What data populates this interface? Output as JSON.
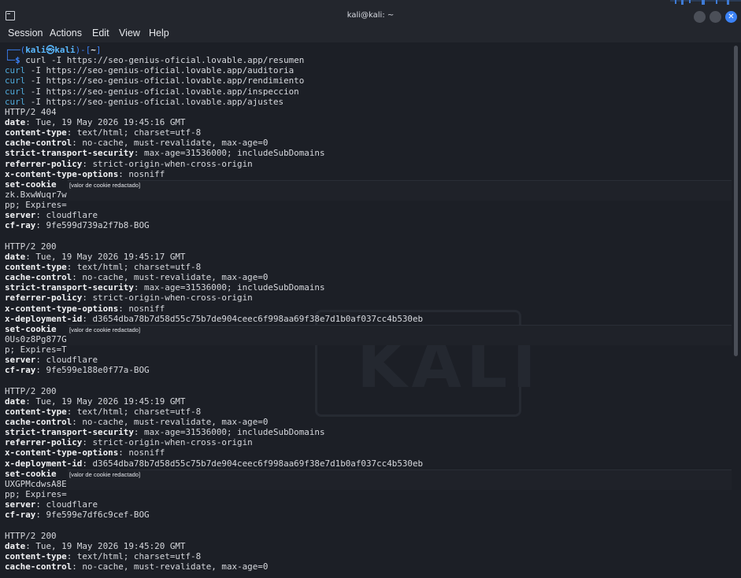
{
  "window": {
    "title": "kali@kali: ~",
    "close_glyph": "✕",
    "icons": [
      "terminal-icon",
      "minimize-icon",
      "maximize-icon",
      "close-icon"
    ]
  },
  "menu": [
    "Session",
    "Actions",
    "Edit",
    "View",
    "Help"
  ],
  "prompt": {
    "open": "┌──(",
    "user": "kali㉿kali",
    "mid": ")-[",
    "path": "~",
    "close": "]",
    "arrow": "└─",
    "dollar": "$",
    "command": " curl -I https://seo-genius-oficial.lovable.app/resumen"
  },
  "commands": [
    {
      "cmd": "curl",
      "rest": " -I https://seo-genius-oficial.lovable.app/auditoria"
    },
    {
      "cmd": "curl",
      "rest": " -I https://seo-genius-oficial.lovable.app/rendimiento"
    },
    {
      "cmd": "curl",
      "rest": " -I https://seo-genius-oficial.lovable.app/inspeccion"
    },
    {
      "cmd": "curl",
      "rest": " -I https://seo-genius-oficial.lovable.app/ajustes"
    }
  ],
  "redaction_label": "[valor de cookie redactado]",
  "responses": [
    {
      "status": "HTTP/2 404",
      "headers": [
        {
          "k": "date",
          "v": ": Tue, 19 May 2026 19:45:16 GMT"
        },
        {
          "k": "content-type",
          "v": ": text/html; charset=utf-8"
        },
        {
          "k": "cache-control",
          "v": ": no-cache, must-revalidate, max-age=0"
        },
        {
          "k": "strict-transport-security",
          "v": ": max-age=31536000; includeSubDomains"
        },
        {
          "k": "referrer-policy",
          "v": ": strict-origin-when-cross-origin"
        },
        {
          "k": "x-content-type-options",
          "v": ": nosniff"
        },
        {
          "k": "set-cookie",
          "v": ""
        }
      ],
      "cookie_lines": [
        "zk.BxwWuqr7w",
        "pp; Expires="
      ],
      "tail": [
        {
          "k": "server",
          "v": ": cloudflare"
        },
        {
          "k": "cf-ray",
          "v": ": 9fe599d739a2f7b8-BOG"
        }
      ]
    },
    {
      "status": "HTTP/2 200",
      "headers": [
        {
          "k": "date",
          "v": ": Tue, 19 May 2026 19:45:17 GMT"
        },
        {
          "k": "content-type",
          "v": ": text/html; charset=utf-8"
        },
        {
          "k": "cache-control",
          "v": ": no-cache, must-revalidate, max-age=0"
        },
        {
          "k": "strict-transport-security",
          "v": ": max-age=31536000; includeSubDomains"
        },
        {
          "k": "referrer-policy",
          "v": ": strict-origin-when-cross-origin"
        },
        {
          "k": "x-content-type-options",
          "v": ": nosniff"
        },
        {
          "k": "x-deployment-id",
          "v": ": d3654dba78b7d58d55c75b7de904ceec6f998aa69f38e7d1b0af037cc4b530eb"
        },
        {
          "k": "set-cookie",
          "v": ""
        }
      ],
      "cookie_lines": [
        "0Us0z8Pg877G",
        "p; Expires=T"
      ],
      "tail": [
        {
          "k": "server",
          "v": ": cloudflare"
        },
        {
          "k": "cf-ray",
          "v": ": 9fe599e188e0f77a-BOG"
        }
      ]
    },
    {
      "status": "HTTP/2 200",
      "headers": [
        {
          "k": "date",
          "v": ": Tue, 19 May 2026 19:45:19 GMT"
        },
        {
          "k": "content-type",
          "v": ": text/html; charset=utf-8"
        },
        {
          "k": "cache-control",
          "v": ": no-cache, must-revalidate, max-age=0"
        },
        {
          "k": "strict-transport-security",
          "v": ": max-age=31536000; includeSubDomains"
        },
        {
          "k": "referrer-policy",
          "v": ": strict-origin-when-cross-origin"
        },
        {
          "k": "x-content-type-options",
          "v": ": nosniff"
        },
        {
          "k": "x-deployment-id",
          "v": ": d3654dba78b7d58d55c75b7de904ceec6f998aa69f38e7d1b0af037cc4b530eb"
        },
        {
          "k": "set-cookie",
          "v": ""
        }
      ],
      "cookie_lines": [
        "UXGPMcdwsA8E",
        "pp; Expires="
      ],
      "tail": [
        {
          "k": "server",
          "v": ": cloudflare"
        },
        {
          "k": "cf-ray",
          "v": ": 9fe599e7df6c9cef-BOG"
        }
      ]
    },
    {
      "status": "HTTP/2 200",
      "headers": [
        {
          "k": "date",
          "v": ": Tue, 19 May 2026 19:45:20 GMT"
        },
        {
          "k": "content-type",
          "v": ": text/html; charset=utf-8"
        },
        {
          "k": "cache-control",
          "v": ": no-cache, must-revalidate, max-age=0"
        }
      ],
      "cookie_lines": [],
      "tail": []
    }
  ],
  "watermark": "KALI",
  "colors": {
    "background": "#1c1f26",
    "prompt_blue": "#3b82f6",
    "command_blue": "#4fa8d8",
    "close_button": "#3b82f6"
  }
}
